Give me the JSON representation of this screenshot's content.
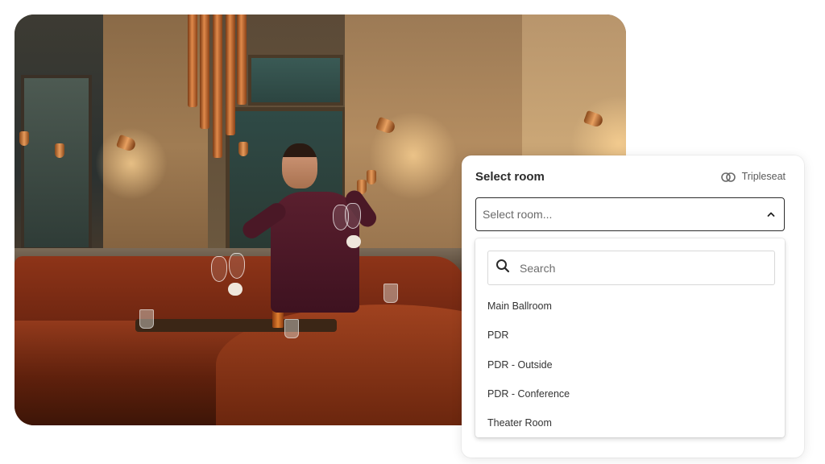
{
  "card": {
    "title": "Select room",
    "brand_label": "Tripleseat",
    "brand_icon": "tripleseat-logo-icon"
  },
  "select": {
    "placeholder": "Select room...",
    "chevron_icon": "chevron-up-icon"
  },
  "dropdown": {
    "search_placeholder": "Search",
    "search_icon": "search-icon",
    "options": [
      "Main Ballroom",
      "PDR",
      "PDR - Outside",
      "PDR - Conference",
      "Theater Room"
    ]
  },
  "colors": {
    "text_primary": "#2b2b2b",
    "border_active": "#2c2c2c",
    "card_bg": "#ffffff"
  }
}
